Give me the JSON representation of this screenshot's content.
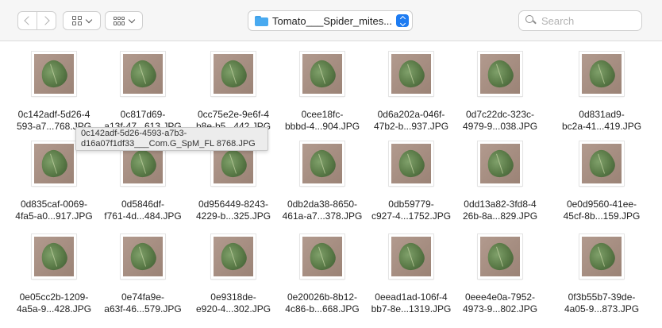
{
  "toolbar": {
    "back_label": "",
    "forward_label": "",
    "path_label": "Tomato___Spider_mites...",
    "search_placeholder": "Search"
  },
  "tooltip": {
    "line1": "0c142adf-5d26-4593-a7b3-",
    "line2": "d16a07f1df33___Com.G_SpM_FL 8768.JPG"
  },
  "files": [
    {
      "line1": "0c142adf-5d26-4",
      "line2": "593-a7...768.JPG"
    },
    {
      "line1": "0c817d69-",
      "line2": "a13f-47...613.JPG"
    },
    {
      "line1": "0cc75e2e-9e6f-4",
      "line2": "b8e-b5...442.JPG"
    },
    {
      "line1": "0cee18fc-",
      "line2": "bbbd-4...904.JPG"
    },
    {
      "line1": "0d6a202a-046f-",
      "line2": "47b2-b...937.JPG"
    },
    {
      "line1": "0d7c22dc-323c-",
      "line2": "4979-9...038.JPG"
    },
    {
      "line1": "0d831ad9-",
      "line2": "bc2a-41...419.JPG"
    },
    {
      "line1": "0d835caf-0069-",
      "line2": "4fa5-a0...917.JPG"
    },
    {
      "line1": "0d5846df-",
      "line2": "f761-4d...484.JPG"
    },
    {
      "line1": "0d956449-8243-",
      "line2": "4229-b...325.JPG"
    },
    {
      "line1": "0db2da38-8650-",
      "line2": "461a-a7...378.JPG"
    },
    {
      "line1": "0db59779-",
      "line2": "c927-4...1752.JPG"
    },
    {
      "line1": "0dd13a82-3fd8-4",
      "line2": "26b-8a...829.JPG"
    },
    {
      "line1": "0e0d9560-41ee-",
      "line2": "45cf-8b...159.JPG"
    },
    {
      "line1": "0e05cc2b-1209-",
      "line2": "4a5a-9...428.JPG"
    },
    {
      "line1": "0e74fa9e-",
      "line2": "a63f-46...579.JPG"
    },
    {
      "line1": "0e9318de-",
      "line2": "e920-4...302.JPG"
    },
    {
      "line1": "0e20026b-8b12-",
      "line2": "4c86-b...668.JPG"
    },
    {
      "line1": "0eead1ad-106f-4",
      "line2": "bb7-8e...1319.JPG"
    },
    {
      "line1": "0eee4e0a-7952-",
      "line2": "4973-9...802.JPG"
    },
    {
      "line1": "0f3b55b7-39de-",
      "line2": "4a05-9...873.JPG"
    }
  ]
}
